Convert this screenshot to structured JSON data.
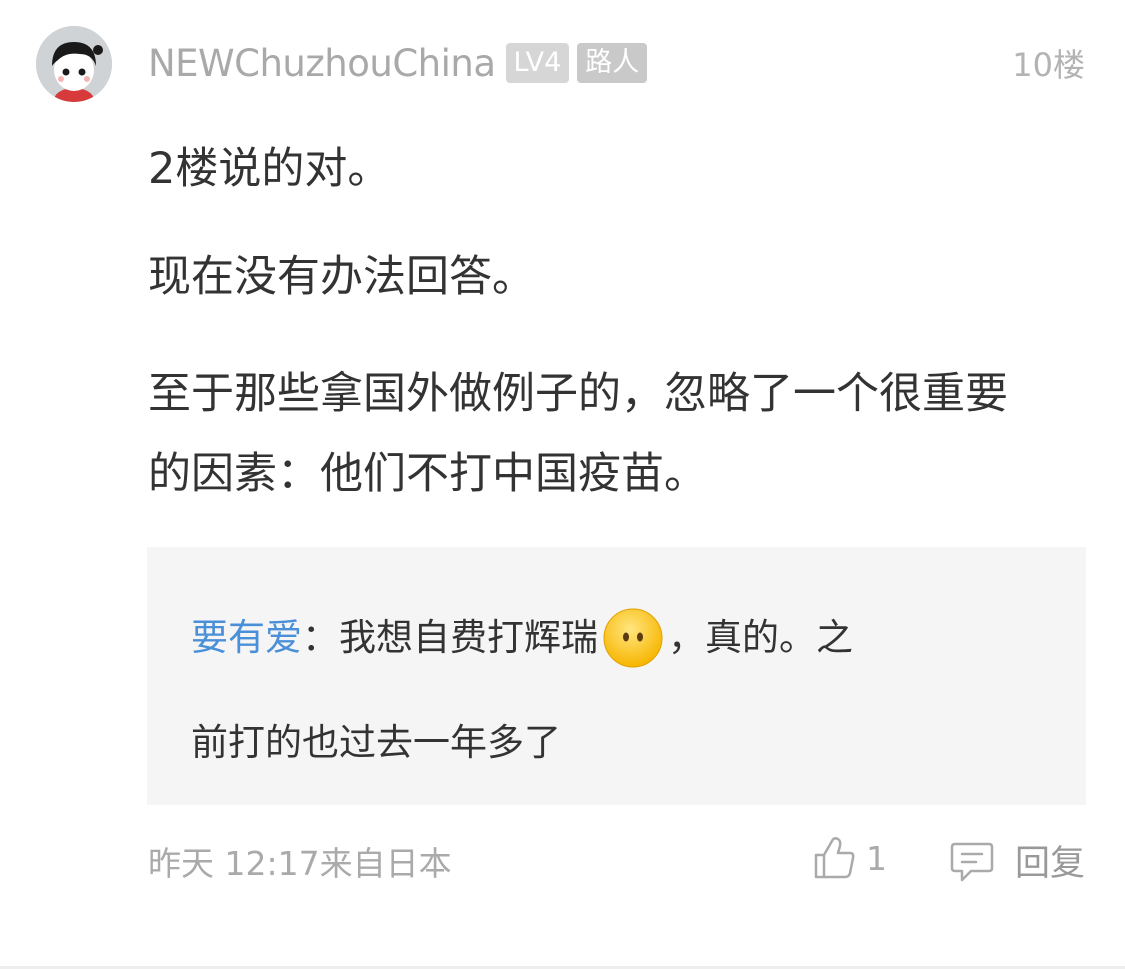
{
  "post": {
    "username": "NEWChuzhouChina",
    "level_badge": "LV4",
    "role_badge": "路人",
    "floor": "10楼",
    "paragraphs": [
      "2楼说的对。",
      "现在没有办法回答。",
      "至于那些拿国外做例子的，忽略了一个很重要的因素：他们不打中国疫苗。"
    ]
  },
  "reply": {
    "user": "要有爱",
    "separator": "：",
    "text_before_emoji": "我想自费打辉瑞",
    "emoji": "no-mouth-face-emoji",
    "text_after_emoji": "，真的。之",
    "text_line2": "前打的也过去一年多了"
  },
  "footer": {
    "time_source": "昨天 12:17来自日本",
    "like_count": "1",
    "reply_label": "回复"
  },
  "colors": {
    "reply_user": "#4a90d9",
    "muted_text": "#aaaaaa",
    "reply_background": "#f5f5f5"
  }
}
